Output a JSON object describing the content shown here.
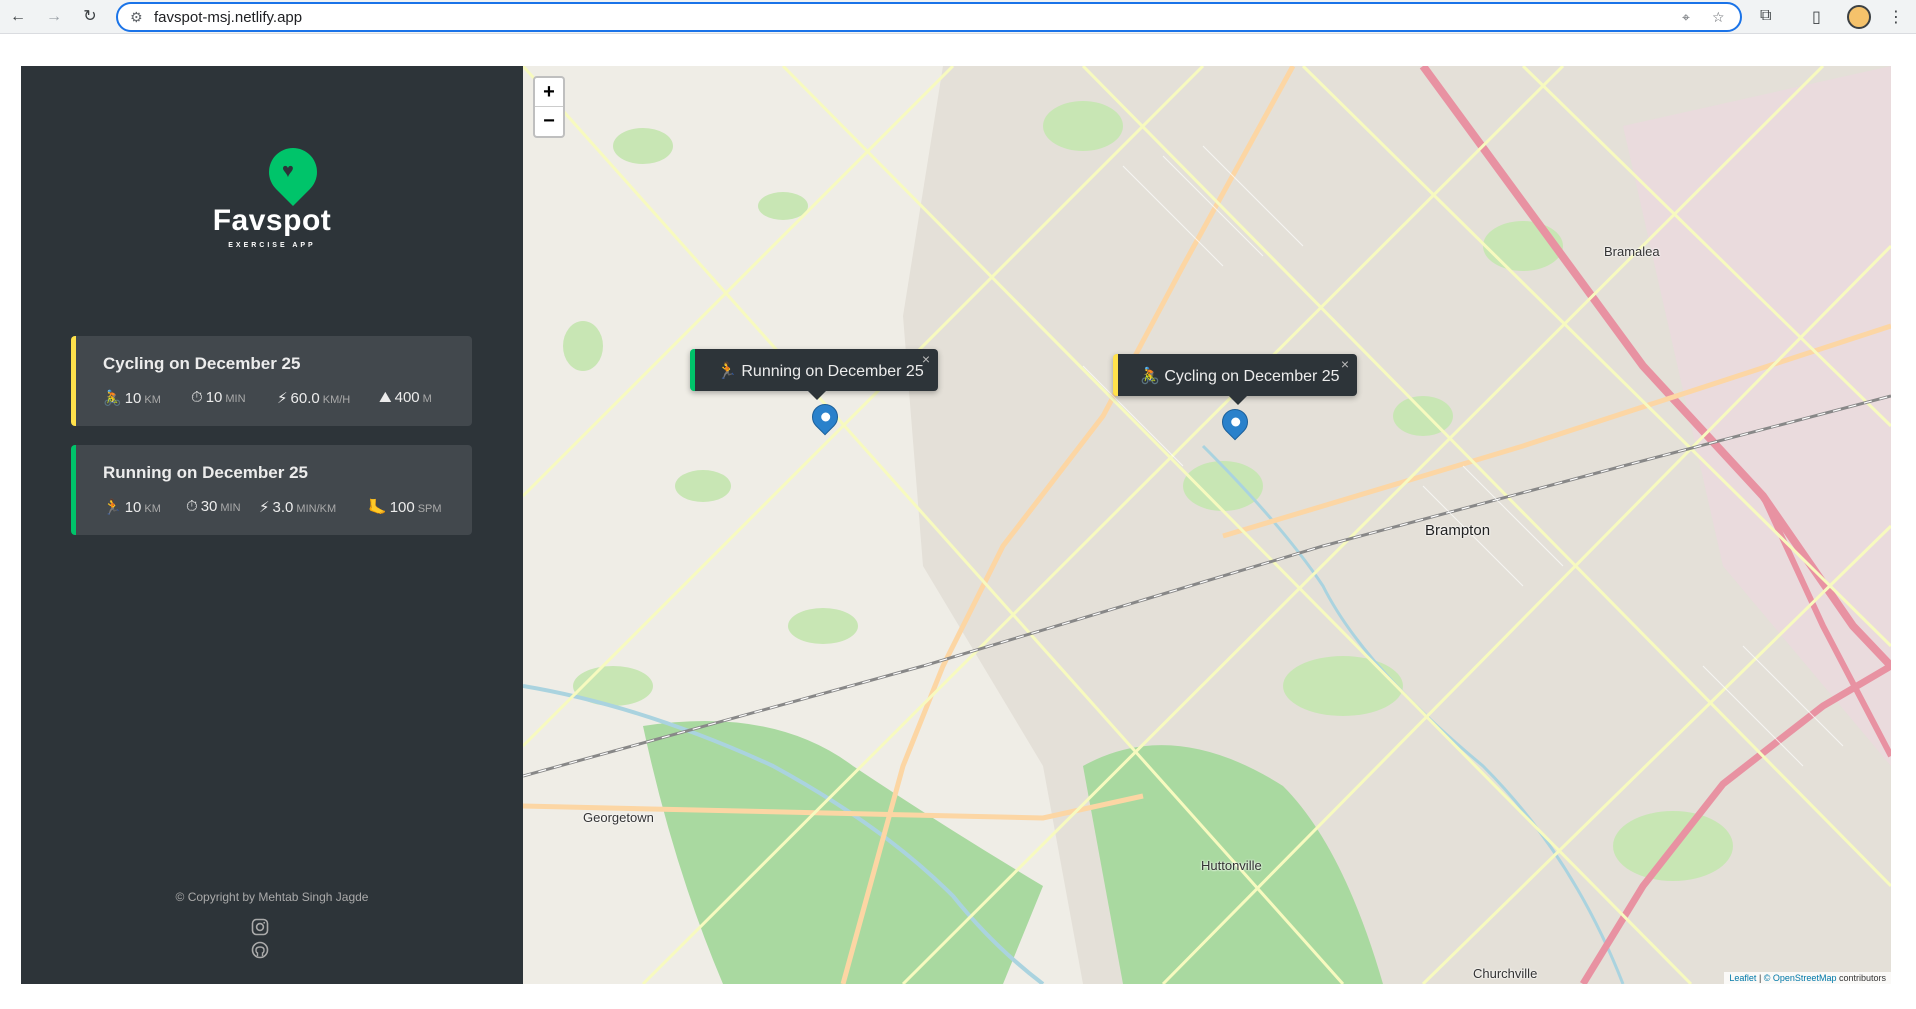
{
  "browser": {
    "url": "favspot-msj.netlify.app",
    "back_icon": "←",
    "forward_icon": "→",
    "reload_icon": "↻"
  },
  "sidebar": {
    "logo_title": "Favspot",
    "logo_subtitle": "EXERCISE APP",
    "workouts": [
      {
        "type": "cycling",
        "title": "Cycling on December 25",
        "color": "#ffe14b",
        "details": [
          {
            "icon": "🚴",
            "value": "10",
            "unit": "km"
          },
          {
            "icon": "⏱",
            "value": "10",
            "unit": "min"
          },
          {
            "icon": "⚡",
            "value": "60.0",
            "unit": "km/h"
          },
          {
            "icon": "⛰",
            "value": "400",
            "unit": "m"
          }
        ]
      },
      {
        "type": "running",
        "title": "Running on December 25",
        "color": "#00c46a",
        "details": [
          {
            "icon": "🏃",
            "value": "10",
            "unit": "km"
          },
          {
            "icon": "⏱",
            "value": "30",
            "unit": "min"
          },
          {
            "icon": "⚡",
            "value": "3.0",
            "unit": "min/km"
          },
          {
            "icon": "🦶",
            "value": "100",
            "unit": "spm"
          }
        ]
      }
    ],
    "copyright": "© Copyright by Mehtab Singh Jagde"
  },
  "map": {
    "zoom_in": "+",
    "zoom_out": "−",
    "popups": {
      "running": {
        "icon": "🏃",
        "text": "Running on December 25",
        "close": "×"
      },
      "cycling": {
        "icon": "🚴",
        "text": "Cycling on December 25",
        "close": "×"
      }
    },
    "places": {
      "brampton": "Brampton",
      "bramalea": "Bramalea",
      "georgetown": "Georgetown",
      "huttonville": "Huttonville",
      "churchville": "Churchville"
    },
    "attribution": {
      "leaflet": "Leaflet",
      "osm": "© OpenStreetMap",
      "contributors": "contributors"
    }
  }
}
